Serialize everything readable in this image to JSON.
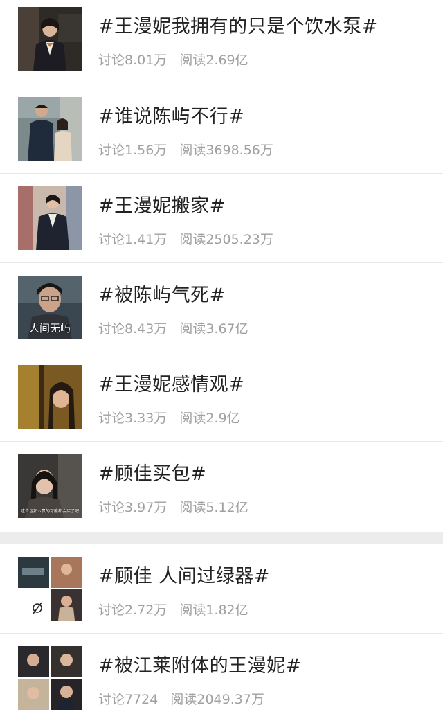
{
  "items": [
    {
      "title": "#王漫妮我拥有的只是个饮水泵#",
      "discuss": "讨论8.01万",
      "read": "阅读2.69亿"
    },
    {
      "title": "#谁说陈屿不行#",
      "discuss": "讨论1.56万",
      "read": "阅读3698.56万"
    },
    {
      "title": "#王漫妮搬家#",
      "discuss": "讨论1.41万",
      "read": "阅读2505.23万"
    },
    {
      "title": "#被陈屿气死#",
      "discuss": "讨论8.43万",
      "read": "阅读3.67亿",
      "thumb_caption": "人间无屿"
    },
    {
      "title": "#王漫妮感情观#",
      "discuss": "讨论3.33万",
      "read": "阅读2.9亿"
    },
    {
      "title": "#顾佳买包#",
      "discuss": "讨论3.97万",
      "read": "阅读5.12亿",
      "thumb_caption": "这个包那么贵的可能都会买了吧"
    },
    {
      "title": "#顾佳 人间过绿器#",
      "discuss": "讨论2.72万",
      "read": "阅读1.82亿"
    },
    {
      "title": "#被江莱附体的王漫妮#",
      "discuss": "讨论7724",
      "read": "阅读2049.37万"
    }
  ]
}
